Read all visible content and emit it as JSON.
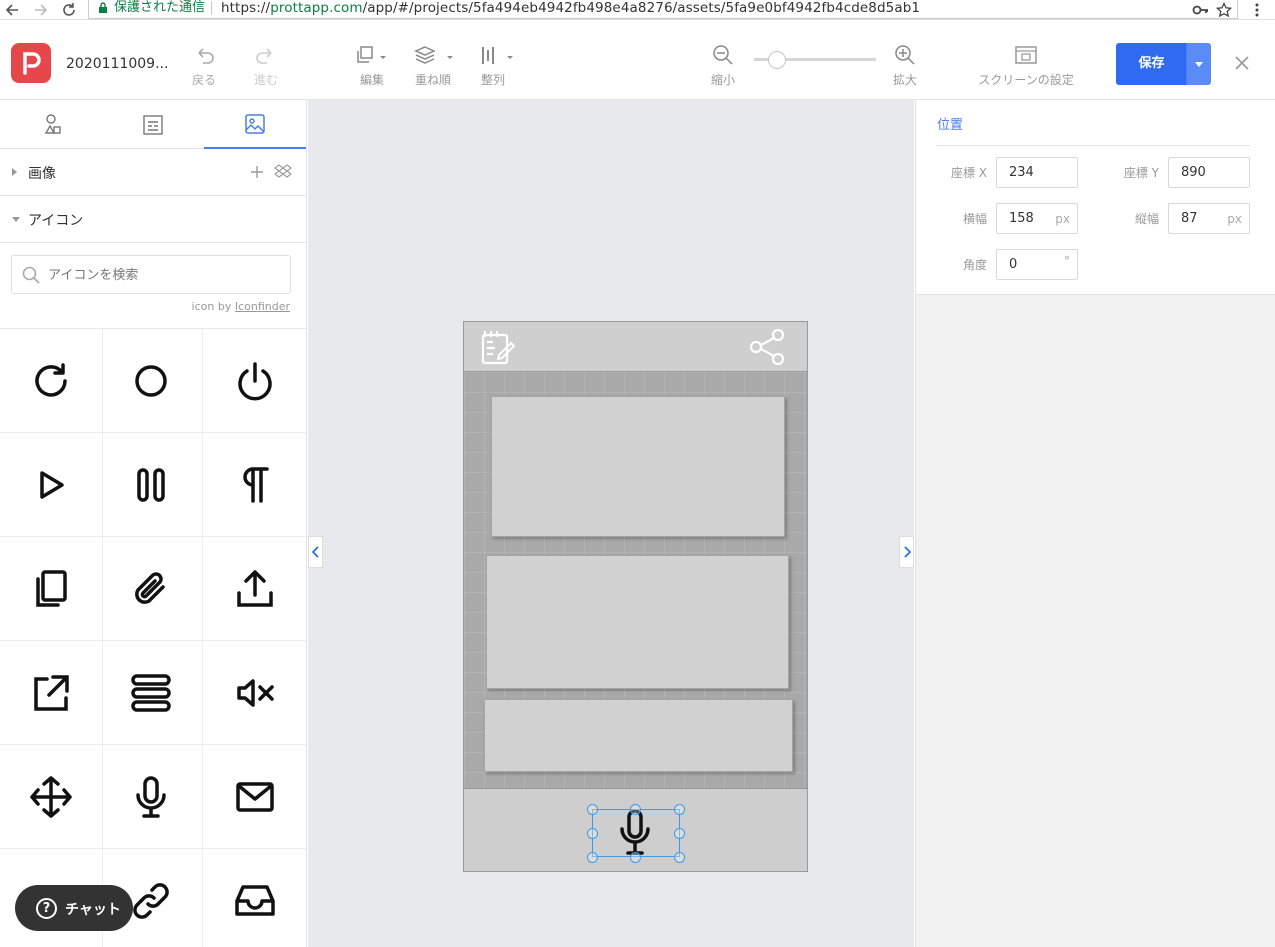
{
  "browser": {
    "secure_label": "保護された通信",
    "url_scheme": "https://",
    "url_host": "prottapp.com",
    "url_path": "/app/#/projects/5fa494eb4942fb498e4a8276/assets/5fa9e0bf4942fb4cde8d5ab1"
  },
  "toolbar": {
    "project_name": "2020111009...",
    "undo": "戻る",
    "redo": "進む",
    "edit": "編集",
    "arrange": "重ね順",
    "align": "整列",
    "zoom_out": "縮小",
    "zoom_in": "拡大",
    "screen_settings": "スクリーンの設定",
    "save": "保存",
    "zoom_level": 0.15
  },
  "left_panel": {
    "images_section": "画像",
    "icons_section": "アイコン",
    "search_placeholder": "アイコンを検索",
    "credit_prefix": "icon by",
    "credit_link": "Iconfinder",
    "icons": [
      "refresh-icon",
      "circle-icon",
      "power-icon",
      "play-icon",
      "pause-icon",
      "pilcrow-icon",
      "copy-icon",
      "paperclip-icon",
      "upload-icon",
      "external-link-icon",
      "menu-icon",
      "mute-icon",
      "move-icon",
      "mic-icon",
      "mail-icon",
      "timer-icon",
      "link-icon",
      "inbox-icon"
    ],
    "chat": "チャット"
  },
  "properties": {
    "title": "位置",
    "x_label": "座標 X",
    "x_value": "234",
    "y_label": "座標 Y",
    "y_value": "890",
    "width_label": "横幅",
    "width_value": "158",
    "height_label": "縦幅",
    "height_value": "87",
    "unit": "px",
    "angle_label": "角度",
    "angle_value": "0",
    "angle_unit": "°"
  },
  "colors": {
    "accent": "#2f6bf2",
    "logo": "#e5474b",
    "selection": "#3a9be8"
  }
}
